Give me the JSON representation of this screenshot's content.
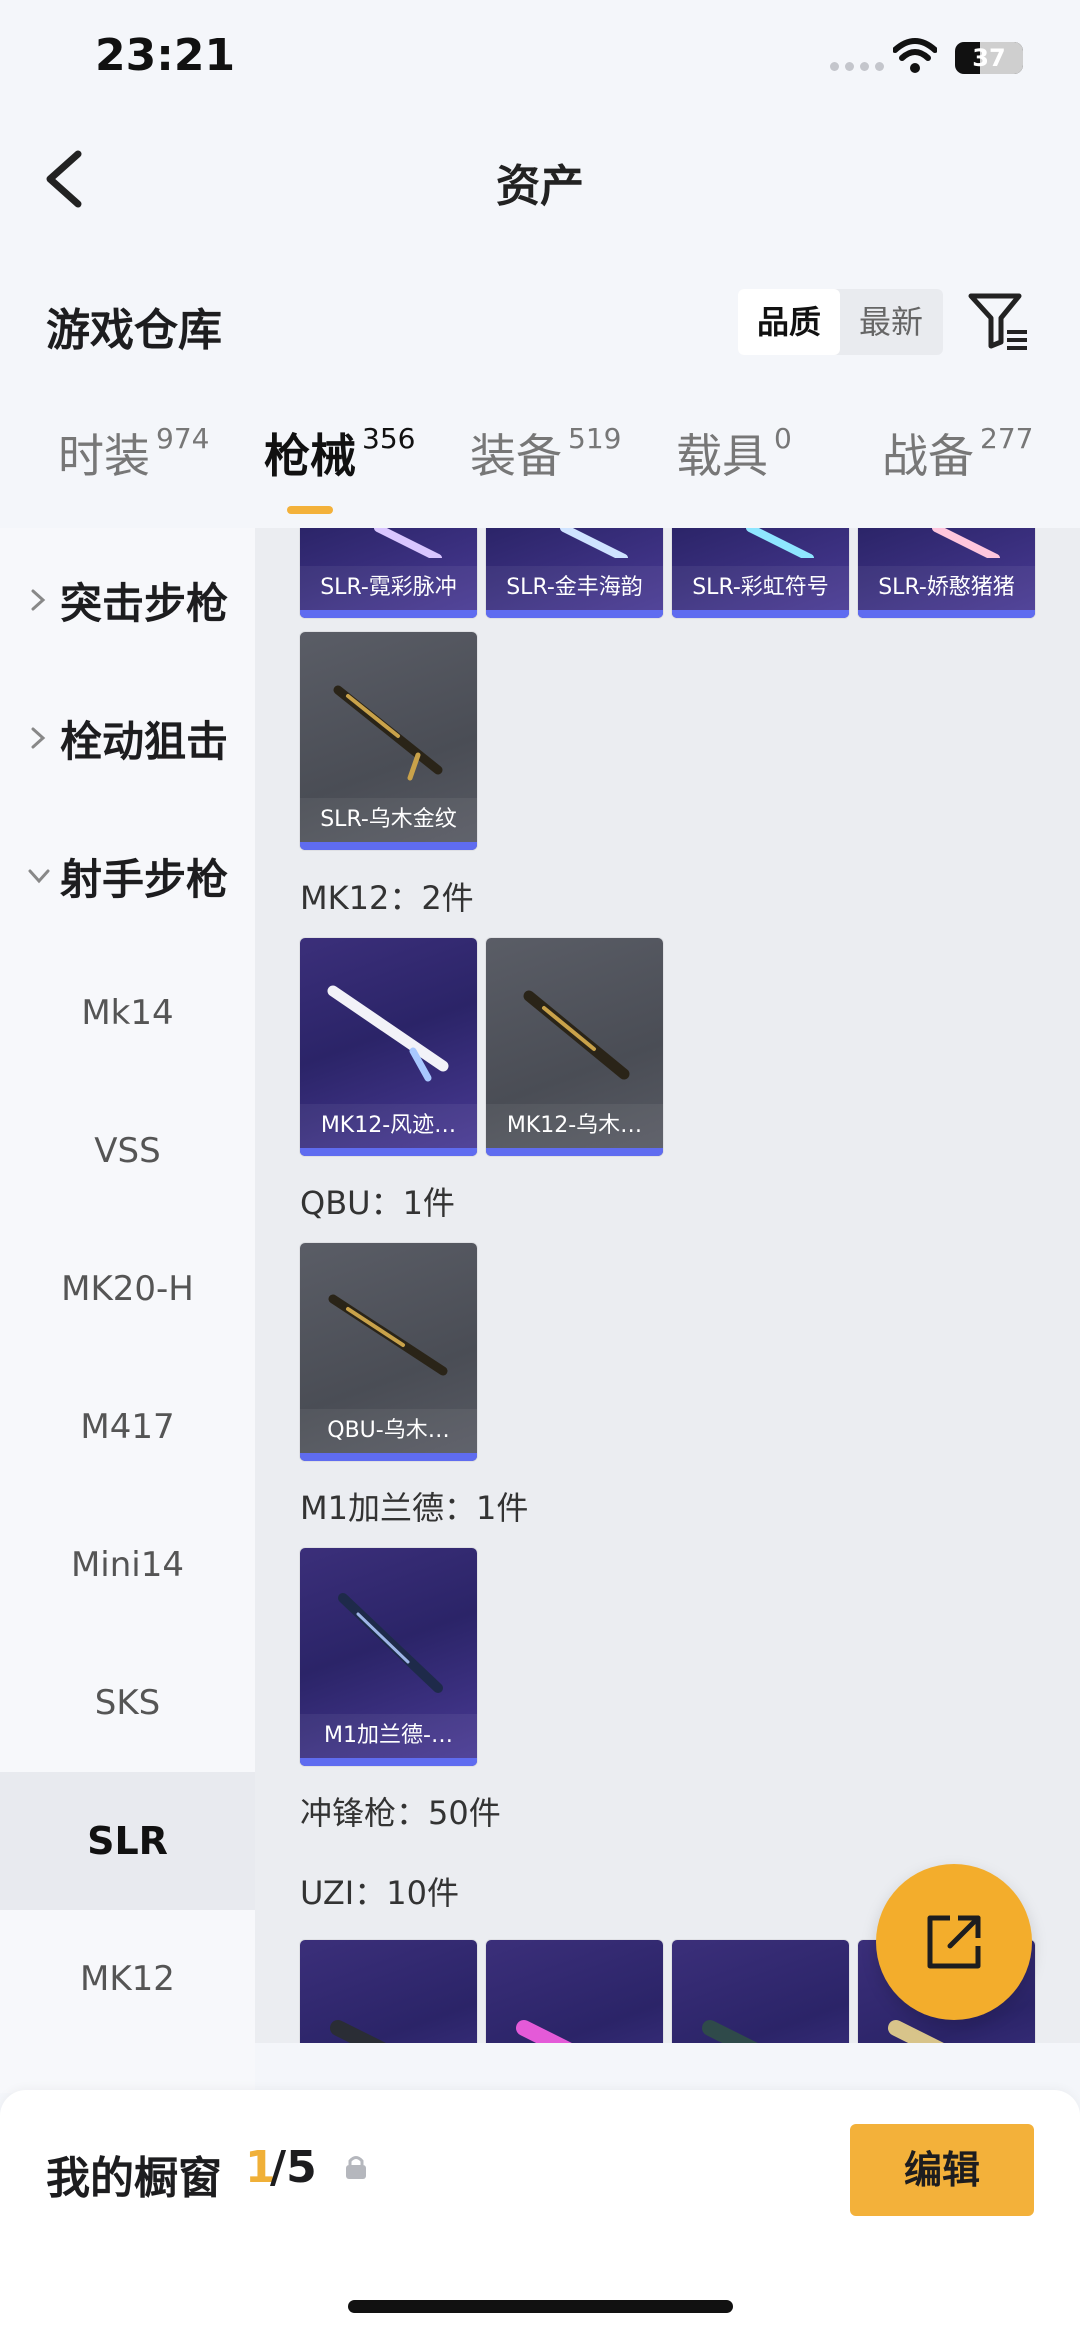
{
  "status": {
    "time": "23:21",
    "battery": "37",
    "battery_level": 0.37
  },
  "header": {
    "title": "资产"
  },
  "section": {
    "title": "游戏仓库"
  },
  "sort": {
    "options": [
      "品质",
      "最新"
    ],
    "active": "品质"
  },
  "tabs": [
    {
      "label": "时装",
      "count": "974"
    },
    {
      "label": "枪械",
      "count": "356",
      "active": true
    },
    {
      "label": "装备",
      "count": "519"
    },
    {
      "label": "载具",
      "count": "0"
    },
    {
      "label": "战备",
      "count": "277"
    }
  ],
  "sidebar": {
    "categories": [
      {
        "label": "突击步枪",
        "expanded": false
      },
      {
        "label": "栓动狙击",
        "expanded": false
      },
      {
        "label": "射手步枪",
        "expanded": true
      }
    ],
    "items": [
      "Mk14",
      "VSS",
      "MK20-H",
      "M417",
      "Mini14",
      "SKS",
      "SLR",
      "MK12"
    ],
    "active_item": "SLR"
  },
  "content": {
    "slr_partial_cards": [
      "SLR-霓彩脉冲",
      "SLR-金丰海韵",
      "SLR-彩虹符号",
      "SLR-娇憨猪猪"
    ],
    "slr_card": "SLR-乌木金纹",
    "groups": [
      {
        "title": "MK12：2件",
        "cards": [
          "MK12-风迹…",
          "MK12-乌木…"
        ]
      },
      {
        "title": "QBU：1件",
        "cards": [
          "QBU-乌木…"
        ]
      },
      {
        "title": "M1加兰德：1件",
        "cards": [
          "M1加兰德-…"
        ]
      }
    ],
    "smg_title": "冲锋枪：50件",
    "uzi_title": "UZI：10件"
  },
  "colors": {
    "accent": "#f3b13a",
    "card_purple": "#2b2468",
    "card_gray": "#4a4d55",
    "rarity_bar": "#5f6cf0"
  },
  "bottom": {
    "showcase_label": "我的橱窗",
    "current": "1",
    "total": "/5",
    "edit_label": "编辑"
  }
}
